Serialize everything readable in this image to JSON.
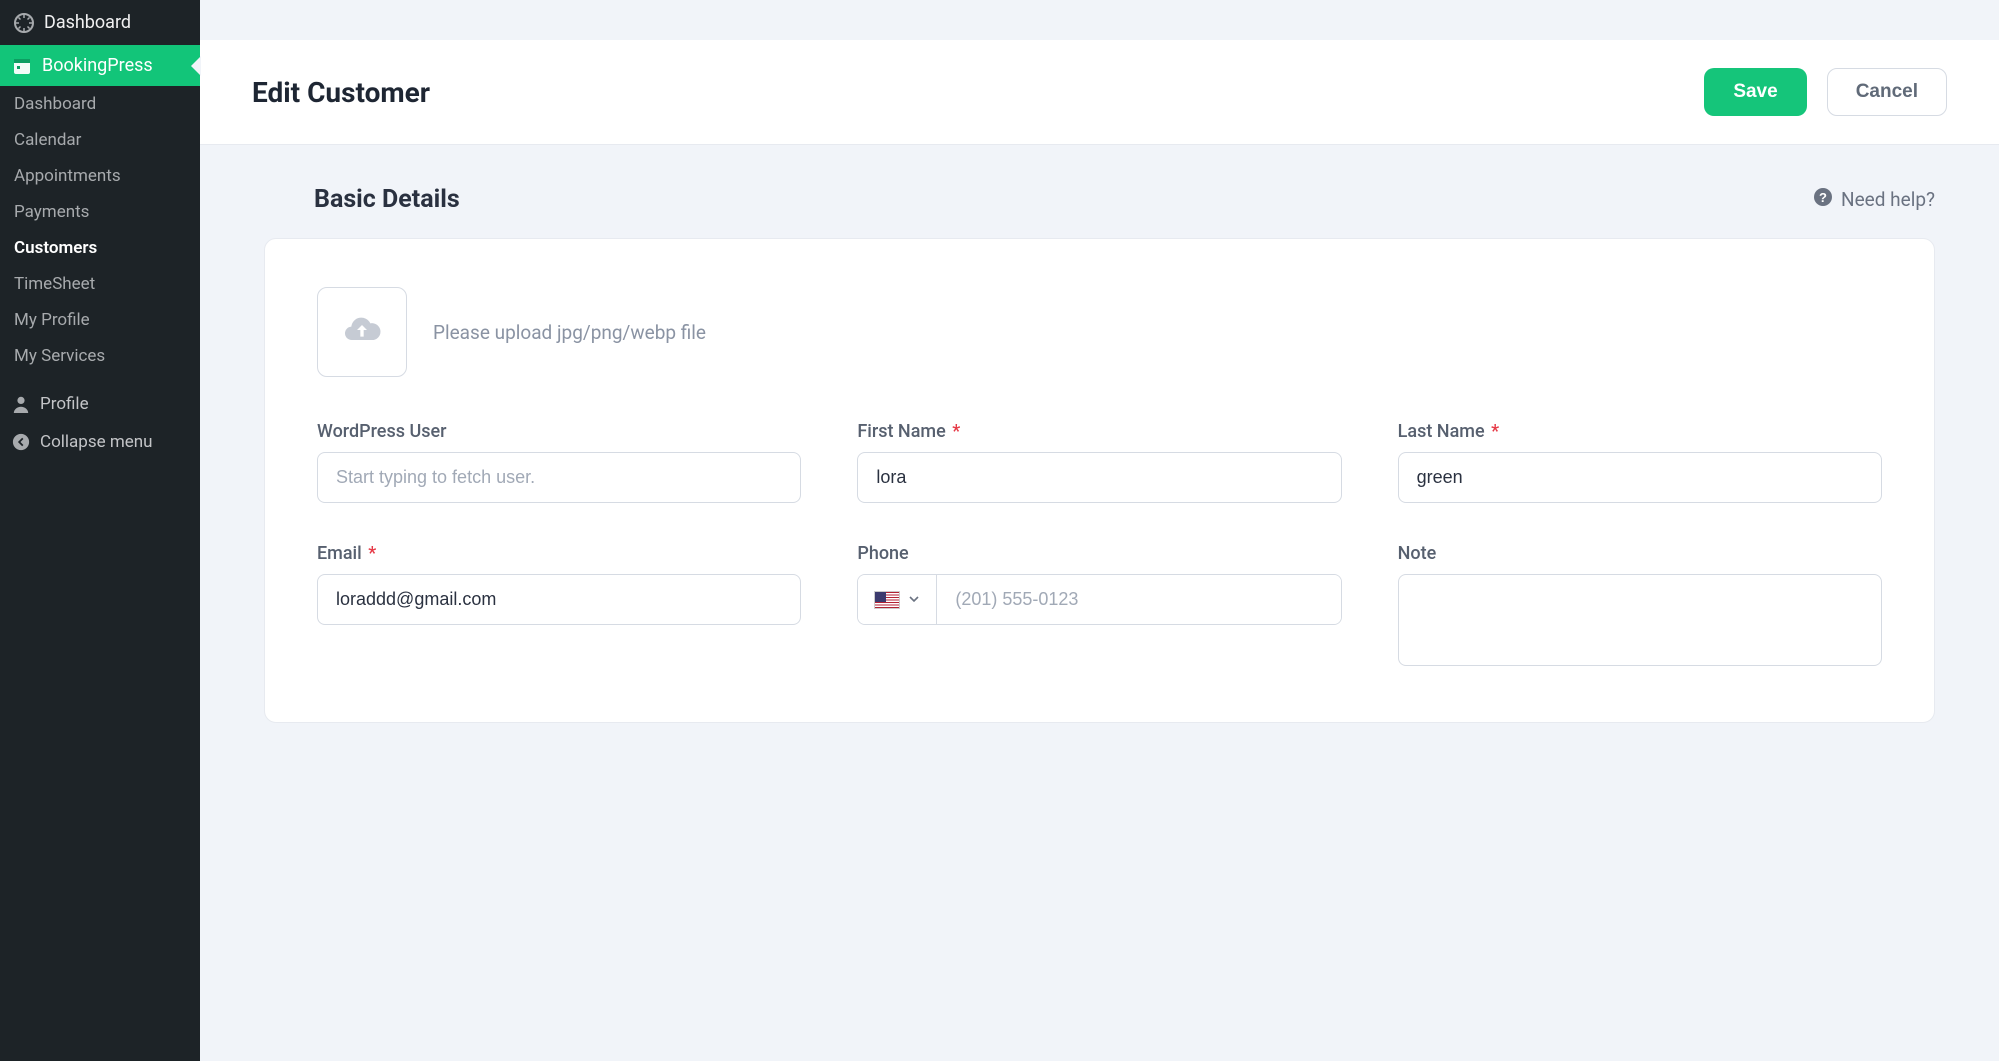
{
  "sidebar": {
    "top": {
      "label": "Dashboard"
    },
    "plugin": {
      "label": "BookingPress"
    },
    "sub": [
      {
        "label": "Dashboard",
        "selected": false
      },
      {
        "label": "Calendar",
        "selected": false
      },
      {
        "label": "Appointments",
        "selected": false
      },
      {
        "label": "Payments",
        "selected": false
      },
      {
        "label": "Customers",
        "selected": true
      },
      {
        "label": "TimeSheet",
        "selected": false
      },
      {
        "label": "My Profile",
        "selected": false
      },
      {
        "label": "My Services",
        "selected": false
      }
    ],
    "profile": "Profile",
    "collapse": "Collapse menu"
  },
  "header": {
    "title": "Edit Customer",
    "save": "Save",
    "cancel": "Cancel"
  },
  "section": {
    "title": "Basic Details",
    "help": "Need help?"
  },
  "form": {
    "upload_hint": "Please upload jpg/png/webp file",
    "wp_user": {
      "label": "WordPress User",
      "placeholder": "Start typing to fetch user.",
      "value": ""
    },
    "first_name": {
      "label": "First Name",
      "value": "lora"
    },
    "last_name": {
      "label": "Last Name",
      "value": "green"
    },
    "email": {
      "label": "Email",
      "value": "loraddd@gmail.com"
    },
    "phone": {
      "label": "Phone",
      "placeholder": "(201) 555-0123",
      "value": ""
    },
    "note": {
      "label": "Note",
      "value": ""
    }
  }
}
